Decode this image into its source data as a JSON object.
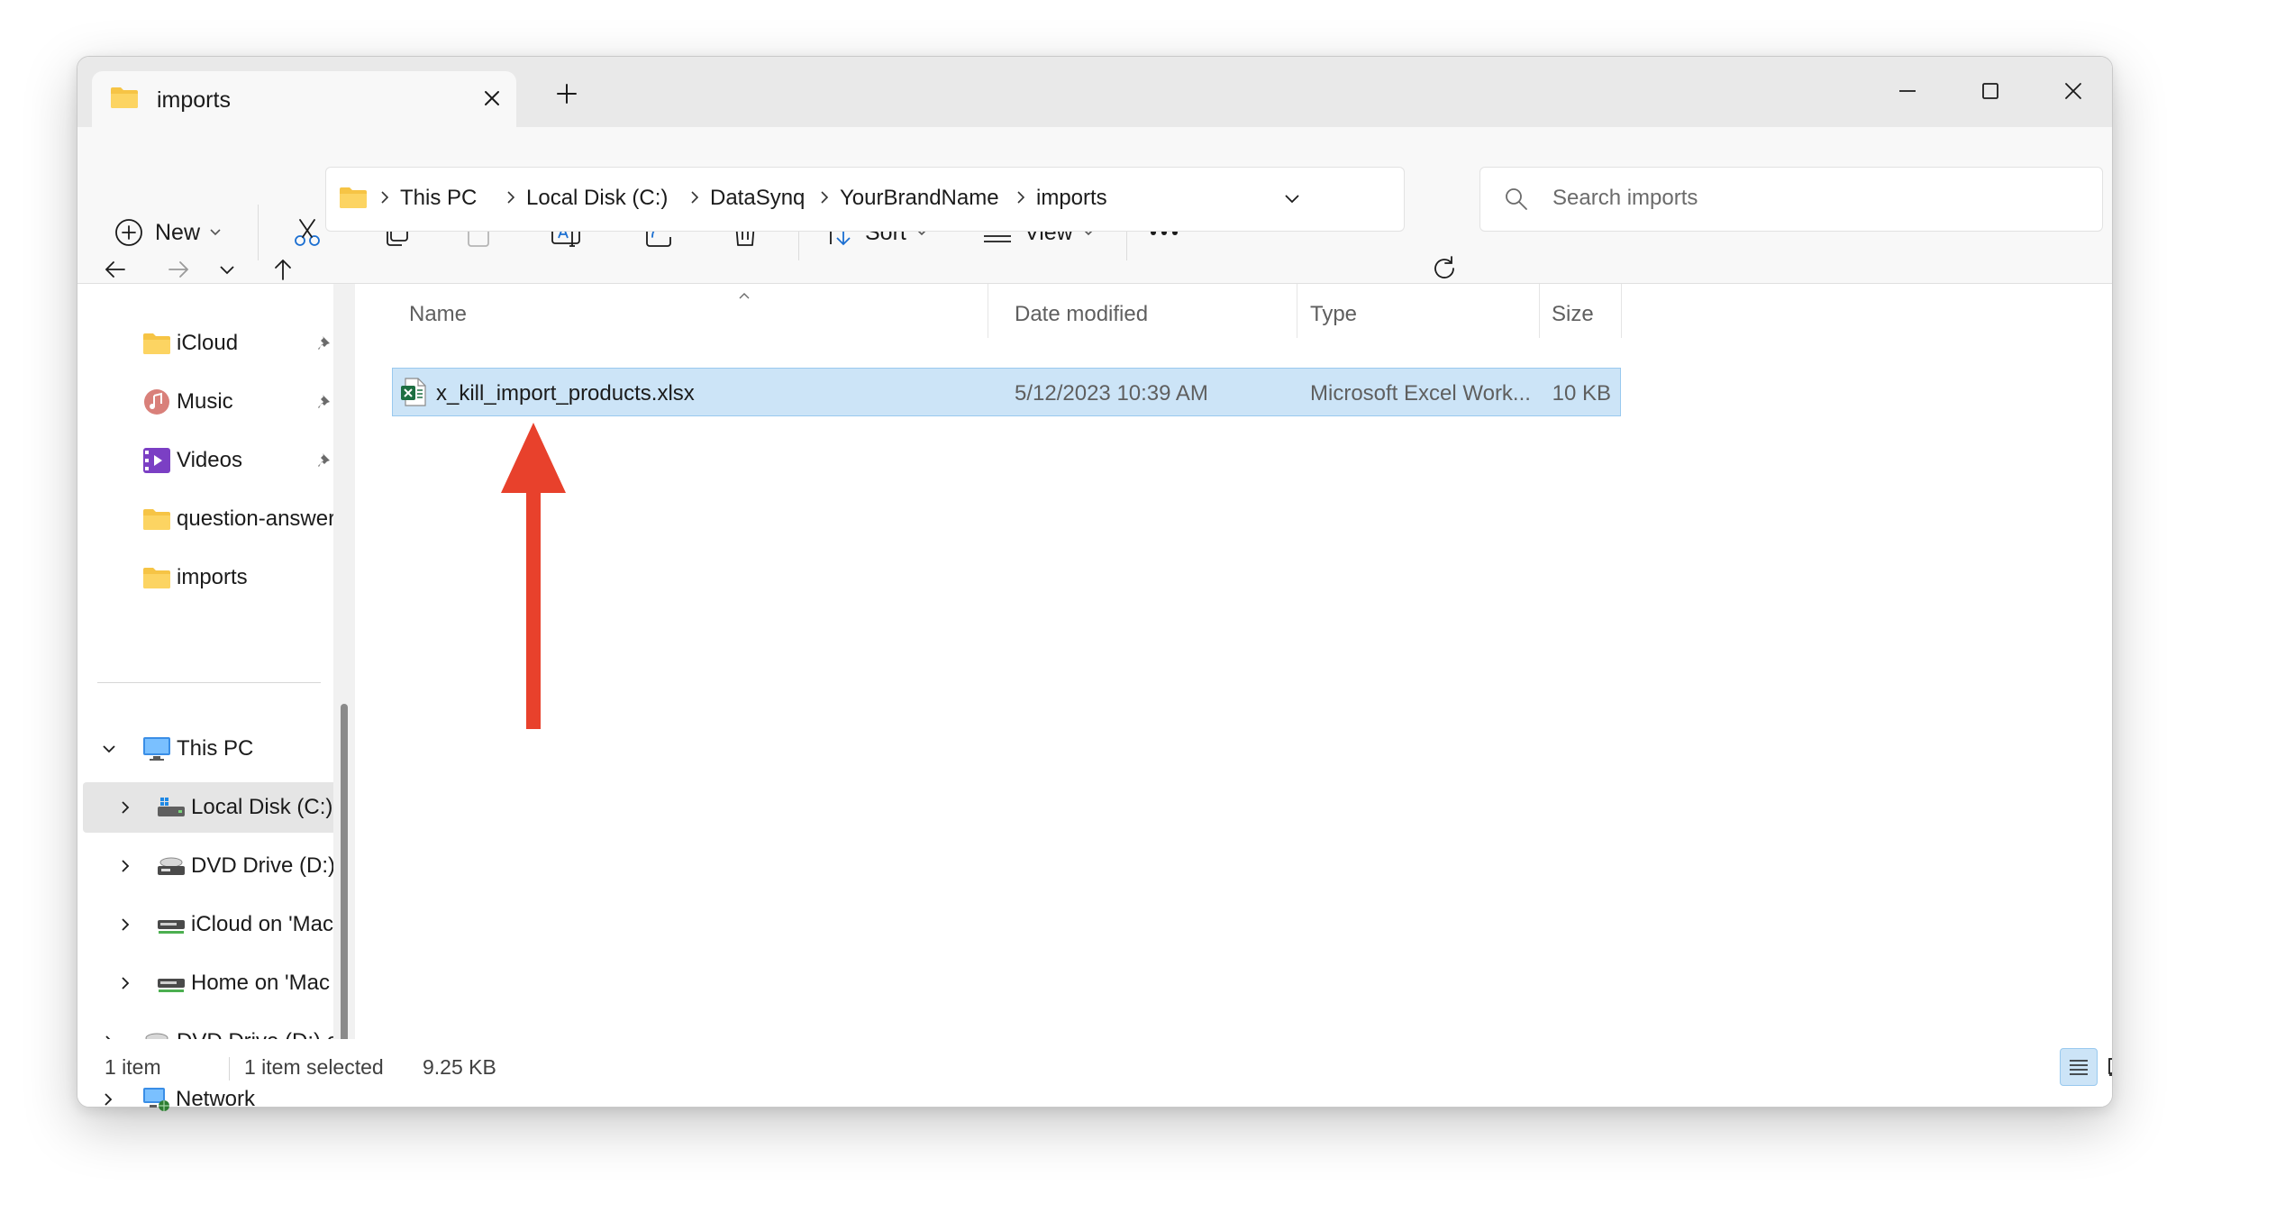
{
  "window": {
    "tab_title": "imports"
  },
  "toolbar": {
    "new_label": "New",
    "sort_label": "Sort",
    "view_label": "View"
  },
  "address": {
    "crumbs": [
      "This PC",
      "Local Disk (C:)",
      "DataSynq",
      "YourBrandName",
      "imports"
    ]
  },
  "search": {
    "placeholder": "Search imports"
  },
  "nav": {
    "quick_access": [
      {
        "label": "iCloud",
        "icon": "folder-icon"
      },
      {
        "label": "Music",
        "icon": "music-icon"
      },
      {
        "label": "Videos",
        "icon": "videos-icon"
      },
      {
        "label": "question-answer",
        "icon": "folder-icon"
      },
      {
        "label": "imports",
        "icon": "folder-icon"
      }
    ],
    "this_pc": "This PC",
    "drives": [
      {
        "label": "Local Disk (C:)",
        "icon": "local-disk-icon"
      },
      {
        "label": "DVD Drive (D:)",
        "icon": "dvd-drive-icon"
      },
      {
        "label": "iCloud on 'Mac",
        "icon": "network-drive-icon"
      },
      {
        "label": "Home on 'Mac",
        "icon": "network-drive-icon"
      }
    ],
    "dvd_drive_root": "DVD Drive (D:) e",
    "network": "Network"
  },
  "columns": {
    "name": "Name",
    "date": "Date modified",
    "type": "Type",
    "size": "Size"
  },
  "files": [
    {
      "name": "x_kill_import_products.xlsx",
      "date": "5/12/2023 10:39 AM",
      "type": "Microsoft Excel Work...",
      "size": "10 KB"
    }
  ],
  "status": {
    "count": "1 item",
    "selection": "1 item selected",
    "selected_size": "9.25 KB"
  },
  "colors": {
    "selection_fill": "#cce4f7",
    "selection_border": "#99c9ef",
    "annotation_arrow": "#e8412c",
    "folder": "#f6c445"
  }
}
